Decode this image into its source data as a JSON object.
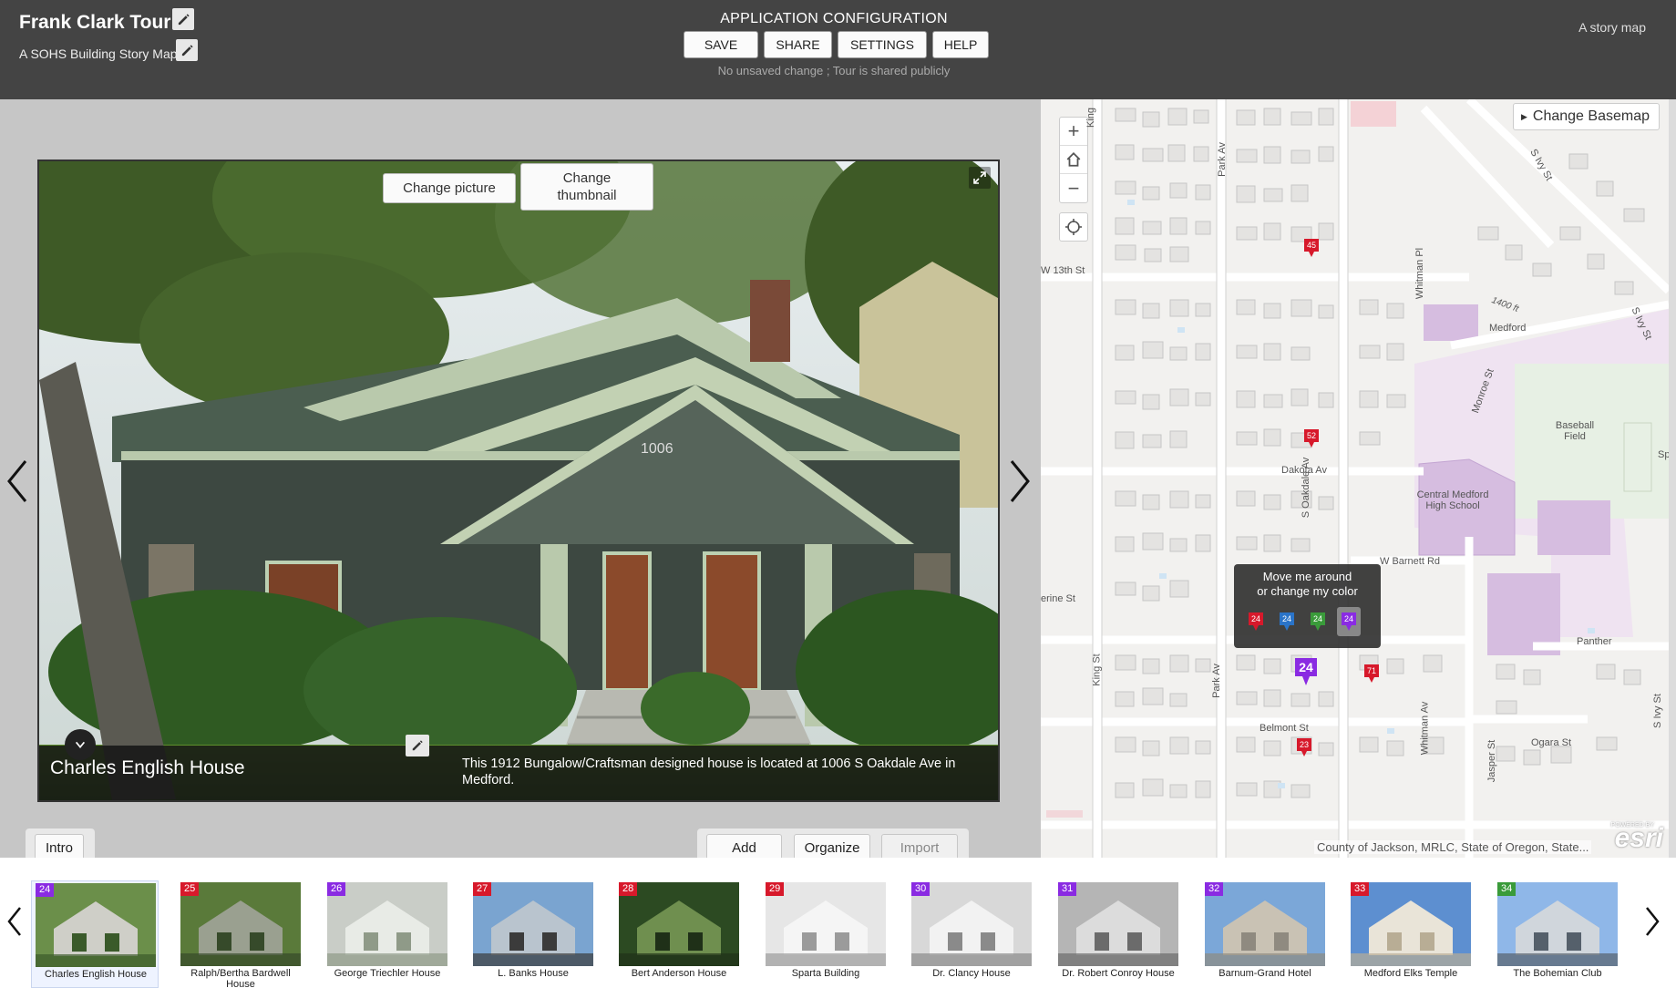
{
  "header": {
    "title": "Frank Clark Tour",
    "subtitle": "A SOHS Building Story Map",
    "config_title": "APPLICATION CONFIGURATION",
    "buttons": {
      "save": "SAVE",
      "share": "SHARE",
      "settings": "SETTINGS",
      "help": "HELP"
    },
    "status": "No unsaved change ; Tour is shared publicly",
    "story_label": "A story map"
  },
  "photo": {
    "change_picture": "Change picture",
    "change_thumbnail": "Change thumbnail",
    "house_number": "1006",
    "caption_title": "Charles English House",
    "caption_desc": "This 1912 Bungalow/Craftsman designed house is located at 1006 S Oakdale Ave in Medford."
  },
  "toolbar": {
    "intro": "Intro",
    "add": "Add",
    "organize": "Organize",
    "import": "Import"
  },
  "map": {
    "zoom_in": "+",
    "zoom_out": "−",
    "change_basemap": "Change Basemap",
    "streets": {
      "king_top": "King",
      "park_av_top": "Park Av",
      "w_13th": "W 13th St",
      "whitman_pl": "Whitman Pl",
      "s_ivy_top": "S Ivy St",
      "s_ivy_right": "S Ivy St",
      "monroe": "Monroe St",
      "dakota": "Dakota Av",
      "s_oakdale": "S Oakdale Av",
      "w_barnett": "W Barnett Rd",
      "erine": "erine St",
      "king_st": "King St",
      "park_av_bottom": "Park Av",
      "belmont": "Belmont St",
      "whitman_av": "Whitman Av",
      "ogara": "Ogara St",
      "jasper": "Jasper St",
      "panther": "Panther",
      "s_ivy_bottom": "S Ivy St",
      "sp": "Sp"
    },
    "places": {
      "addr_1400": "1400 ft",
      "medford": "Medford",
      "baseball": "Baseball Field",
      "school": "Central Medford High School"
    },
    "attribution": "County of Jackson, MRLC, State of Oregon, State...",
    "esri_small": "POWERED BY",
    "esri": "esri",
    "pins": [
      "45",
      "52",
      "24",
      "71",
      "23"
    ],
    "popup": {
      "line1": "Move me around",
      "line2": "or change my color",
      "choices": [
        "24",
        "24",
        "24",
        "24"
      ]
    },
    "colors": {
      "red": "#d7192b",
      "blue": "#2a74c9",
      "green": "#3a9b3a",
      "purple": "#8a2be2"
    }
  },
  "carousel": {
    "items": [
      {
        "num": "24",
        "label": "Charles English House",
        "color": "#8a2be2"
      },
      {
        "num": "25",
        "label": "Ralph/Bertha Bardwell House",
        "color": "#d7192b"
      },
      {
        "num": "26",
        "label": "George Triechler House",
        "color": "#8a2be2"
      },
      {
        "num": "27",
        "label": "L. Banks House",
        "color": "#d7192b"
      },
      {
        "num": "28",
        "label": "Bert Anderson House",
        "color": "#d7192b"
      },
      {
        "num": "29",
        "label": "Sparta Building",
        "color": "#d7192b"
      },
      {
        "num": "30",
        "label": "Dr. Clancy House",
        "color": "#8a2be2"
      },
      {
        "num": "31",
        "label": "Dr. Robert Conroy House",
        "color": "#8a2be2"
      },
      {
        "num": "32",
        "label": "Barnum-Grand Hotel",
        "color": "#8a2be2"
      },
      {
        "num": "33",
        "label": "Medford Elks Temple",
        "color": "#d7192b"
      },
      {
        "num": "34",
        "label": "The Bohemian Club",
        "color": "#3a9b3a"
      }
    ]
  }
}
